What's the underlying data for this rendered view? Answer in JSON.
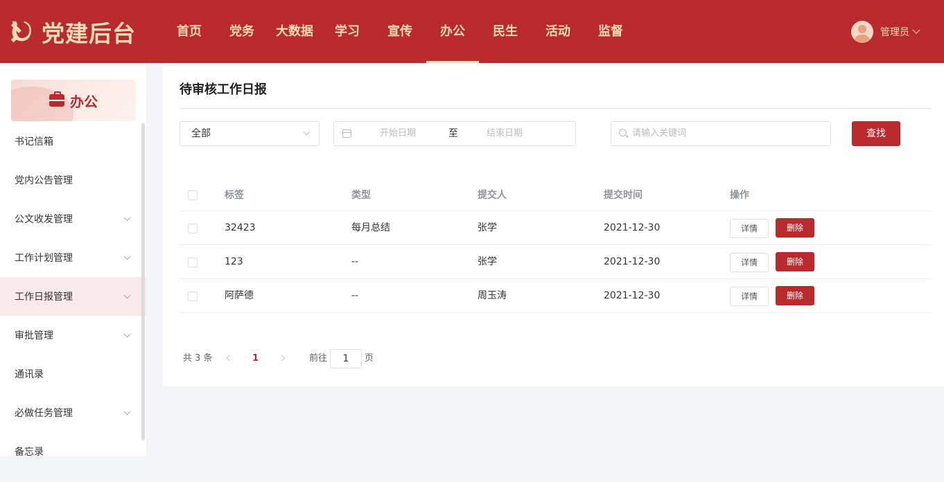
{
  "app": {
    "title": "党建后台",
    "accent_color": "#b82a2e",
    "text_gold": "#f7dcb4"
  },
  "nav": {
    "items": [
      {
        "label": "首页"
      },
      {
        "label": "党务"
      },
      {
        "label": "大数据"
      },
      {
        "label": "学习"
      },
      {
        "label": "宣传"
      },
      {
        "label": "办公",
        "active": true
      },
      {
        "label": "民生"
      },
      {
        "label": "活动"
      },
      {
        "label": "监督"
      }
    ]
  },
  "user": {
    "name": "管理员",
    "icon": "chevron-down-icon"
  },
  "sidebar": {
    "header": "办公",
    "header_icon": "briefcase-icon",
    "items": [
      {
        "label": "书记信箱",
        "expandable": false
      },
      {
        "label": "党内公告管理",
        "expandable": false
      },
      {
        "label": "公文收发管理",
        "expandable": true
      },
      {
        "label": "工作计划管理",
        "expandable": true
      },
      {
        "label": "工作日报管理",
        "expandable": true,
        "active": true
      },
      {
        "label": "审批管理",
        "expandable": true
      },
      {
        "label": "通讯录",
        "expandable": false
      },
      {
        "label": "必做任务管理",
        "expandable": true
      },
      {
        "label": "备忘录",
        "expandable": false
      }
    ]
  },
  "main": {
    "title": "待审核工作日报",
    "filter": {
      "select_value": "全部",
      "date_start_placeholder": "开始日期",
      "date_separator": "至",
      "date_end_placeholder": "结束日期",
      "search_placeholder": "请输入关键词",
      "search_button": "查找"
    },
    "table": {
      "columns": [
        "标签",
        "类型",
        "提交人",
        "提交时间",
        "操作"
      ],
      "rows": [
        {
          "tag": "32423",
          "type": "每月总结",
          "submitter": "张学",
          "time": "2021-12-30",
          "detail": "详情",
          "delete": "删除"
        },
        {
          "tag": "123",
          "type": "--",
          "submitter": "张学",
          "time": "2021-12-30",
          "detail": "详情",
          "delete": "删除"
        },
        {
          "tag": "阿萨德",
          "type": "--",
          "submitter": "周玉涛",
          "time": "2021-12-30",
          "detail": "详情",
          "delete": "删除"
        }
      ]
    },
    "pagination": {
      "total": "共 3 条",
      "current_page": "1",
      "goto_label": "前往",
      "goto_value": "1",
      "unit": "页"
    }
  }
}
